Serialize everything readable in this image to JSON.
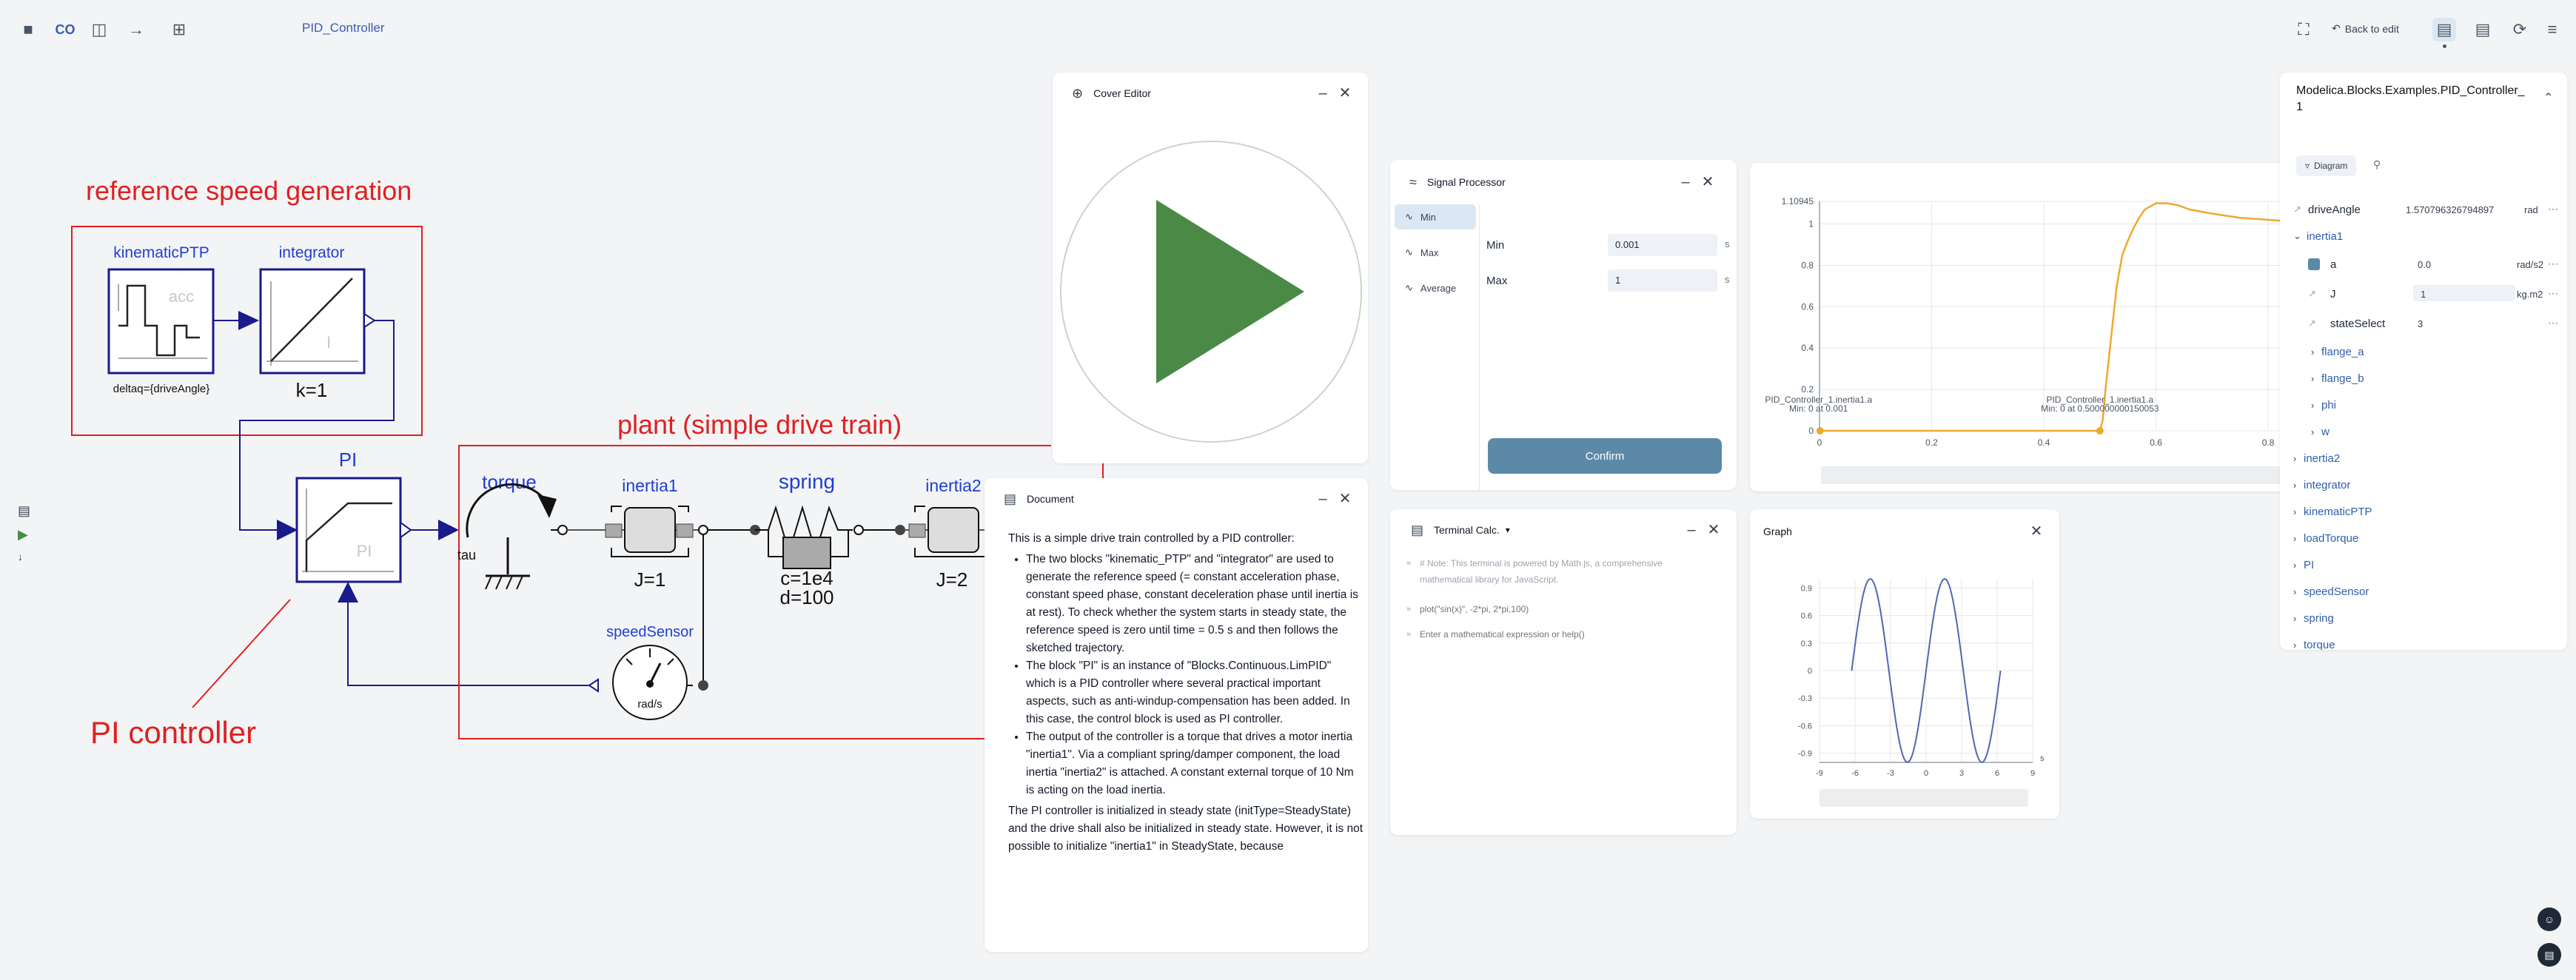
{
  "topbar": {
    "logo": "CO",
    "title": "PID_Controller",
    "back_to_edit": "Back to edit"
  },
  "diagram": {
    "labels": {
      "reference_speed_generation": "reference speed generation",
      "plant": "plant (simple drive train)",
      "pi_controller": "PI controller"
    },
    "blocks": {
      "kinematicPTP": "kinematicPTP",
      "kinematic_inner": "acc",
      "kinematic_param": "deltaq={driveAngle}",
      "integrator": "integrator",
      "integrator_inner": "I",
      "integrator_param": "k=1",
      "pi": "PI",
      "pi_inner": "PI",
      "torque": "torque",
      "tau": "tau",
      "inertia1": "inertia1",
      "inertia1_param": "J=1",
      "spring": "spring",
      "spring_param1": "c=1e4",
      "spring_param2": "d=100",
      "inertia2": "inertia2",
      "inertia2_param": "J=2",
      "speedSensor": "speedSensor",
      "speed_unit": "rad/s"
    }
  },
  "cover_editor": {
    "title": "Cover Editor",
    "play_color": "#4a8a46"
  },
  "document": {
    "title": "Document",
    "intro": "This is a simple drive train controlled by a PID controller:",
    "bullets": [
      "The two blocks \"kinematic_PTP\" and \"integrator\" are used to generate the reference speed (= constant acceleration phase, constant speed phase, constant deceleration phase until inertia is at rest). To check whether the system starts in steady state, the reference speed is zero until time = 0.5 s and then follows the sketched trajectory.",
      "The block \"PI\" is an instance of \"Blocks.Continuous.LimPID\" which is a PID controller where several practical important aspects, such as anti-windup-compensation has been added. In this case, the control block is used as PI controller.",
      "The output of the controller is a torque that drives a motor inertia \"inertia1\". Via a compliant spring/damper component, the load inertia \"inertia2\" is attached. A constant external torque of 10 Nm is acting on the load inertia."
    ],
    "outro": "The PI controller is initialized in steady state (initType=SteadyState) and the drive shall also be initialized in steady state. However, it is not possible to initialize \"inertia1\" in SteadyState, because"
  },
  "signal_processor": {
    "title": "Signal Processor",
    "nav": [
      "Min",
      "Max",
      "Average"
    ],
    "fields": [
      {
        "label": "Min",
        "value": "0.001",
        "unit": "s"
      },
      {
        "label": "Max",
        "value": "1",
        "unit": "s"
      }
    ],
    "confirm": "Confirm"
  },
  "terminal": {
    "title": "Terminal Calc.",
    "note": "# Note: This terminal is powered by Math.js, a comprehensive mathematical library for JavaScript.",
    "command": "plot(\"sin(x)\", -2*pi, 2*pi,100)",
    "placeholder": "Enter a mathematical expression or help()"
  },
  "main_plot": {
    "top_value": "1.10945",
    "annotation1_line1": "PID_Controller_1.inertia1.a",
    "annotation1_line2": "Min: 0 at 0.001",
    "annotation2_line1": "PID_Controller_1.inertia1.a",
    "annotation2_line2": "Min: 0 at 0.500000000150053",
    "series_color": "#f0a830"
  },
  "chart_data": [
    {
      "type": "line",
      "title": "",
      "xlabel": "",
      "ylabel": "",
      "xlim": [
        0,
        1.0
      ],
      "ylim": [
        0,
        1.10945
      ],
      "xticks": [
        "0",
        "0.2",
        "0.4",
        "0.6",
        "0.8"
      ],
      "yticks": [
        "0",
        "0.2",
        "0.4",
        "0.6",
        "0.8",
        "1",
        "1.10945"
      ],
      "series": [
        {
          "x": [
            0,
            0.5,
            0.505,
            0.51,
            0.52,
            0.53,
            0.54,
            0.55,
            0.56,
            0.57,
            0.58,
            0.6,
            0.62,
            0.64,
            0.66,
            0.7,
            0.75,
            0.8,
            0.85,
            0.9,
            0.95,
            1.0
          ],
          "values": [
            0,
            0,
            0.05,
            0.2,
            0.45,
            0.7,
            0.85,
            0.92,
            0.98,
            1.03,
            1.07,
            1.1,
            1.1,
            1.09,
            1.07,
            1.05,
            1.03,
            1.02,
            1.01,
            1.0,
            1.0,
            1.0
          ]
        }
      ]
    },
    {
      "type": "line",
      "title": "Graph",
      "xlabel": "s",
      "ylabel": "",
      "xlim": [
        -9,
        9
      ],
      "ylim": [
        -1,
        1
      ],
      "xticks": [
        "-9",
        "-6",
        "-3",
        "0",
        "3",
        "6",
        "9"
      ],
      "yticks": [
        "0.9",
        "0.6",
        "0.3",
        "0",
        "-0.3",
        "-0.6",
        "-0.9"
      ],
      "series": [
        {
          "function": "sin(x)",
          "x_range": [
            -6.2832,
            6.2832
          ],
          "points": 100
        }
      ]
    }
  ],
  "graph": {
    "title": "Graph",
    "unit": "s",
    "series_color": "#5566b0"
  },
  "properties": {
    "title": "Modelica.Blocks.Examples.PID_Controller_1",
    "tab_diagram": "Diagram",
    "drive_angle": {
      "name": "driveAngle",
      "value": "1.570796326794897",
      "unit": "rad"
    },
    "inertia1": "inertia1",
    "a": {
      "name": "a",
      "value": "0.0",
      "unit": "rad/s2"
    },
    "J": {
      "name": "J",
      "value": "1",
      "unit": "kg.m2"
    },
    "stateSelect": {
      "name": "stateSelect",
      "value": "3"
    },
    "children": [
      "flange_a",
      "flange_b",
      "phi",
      "w"
    ],
    "items": [
      "inertia2",
      "integrator",
      "kinematicPTP",
      "loadTorque",
      "PI",
      "speedSensor",
      "spring",
      "torque"
    ]
  }
}
